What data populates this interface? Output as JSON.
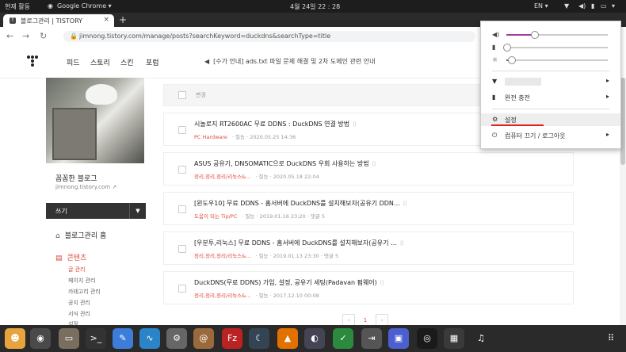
{
  "topbar": {
    "activities": "현재 활동",
    "app": "Google Chrome ▾",
    "datetime": "4월 24일 22 : 28",
    "lang": "EN ▾"
  },
  "tab": {
    "title": "블로그관리 | TISTORY",
    "close": "×",
    "new": "+"
  },
  "address": {
    "url": "jimnong.tistory.com/manage/posts?searchKeyword=duckdns&searchType=title"
  },
  "site": {
    "menu": [
      "피드",
      "스토리",
      "스킨",
      "포럼"
    ],
    "notice": "[수가 안내] ads.txt 파일 문제 해결 및 2차 도메인 관련 안내"
  },
  "sidebar": {
    "blog_name": "꼼꼼한 블로그",
    "blog_url": "jimnong.tistory.com",
    "write": "쓰기",
    "home": "블로그관리 홈",
    "section": "콘텐츠",
    "subs": [
      "글 관리",
      "페이지 관리",
      "카테고리 관리",
      "공지 관리",
      "서식 관리",
      "설정"
    ]
  },
  "list": {
    "header": "변경",
    "posts": [
      {
        "title": "시놀로지 RT2600AC 무료 DDNS : DuckDNS 연결 방법",
        "category": "PC Hardware",
        "meta": "· 질능 · 2020.05.25 14:36"
      },
      {
        "title": "ASUS 공유기, DNSOMATIC으로 DuckDNS 우회 사용하는 방법",
        "category": "정리,정리,정리/리눅스&...",
        "meta": "· 질능 · 2020.05.18 22:04"
      },
      {
        "title": "[윈도우10] 무료 DDNS - 홈서버에 DuckDNS를 설치해보자(공유기 DDN…",
        "category": "도움이 되는 Tip/PC",
        "meta": "· 질능 · 2019.01.16 23:20 · 댓글 5"
      },
      {
        "title": "[우분투,리눅스] 무료 DDNS - 홈서버에 DuckDNS를 설치해보자(공유기 …",
        "category": "정리,정리,정리/리눅스&...",
        "meta": "· 질능 · 2019.01.13 23:30 · 댓글 5"
      },
      {
        "title": "DuckDNS(무료 DDNS) 가입, 설정, 공유기 세팅(Padavan 펌웨어)",
        "category": "정리,정리,정리/리눅스&...",
        "meta": "· 질능 · 2017.12.10 00:08"
      }
    ],
    "page": "1"
  },
  "sysmenu": {
    "volume": 0.27,
    "mic": 0.0,
    "brightness": 0.05,
    "battery": "완전 충전",
    "settings": "설정",
    "power": "컴퓨터 끄기 / 로그아웃"
  },
  "colors": {
    "accent": "#e04a3f",
    "slider": "#a43ca0",
    "dock": "#2a2a2a"
  }
}
